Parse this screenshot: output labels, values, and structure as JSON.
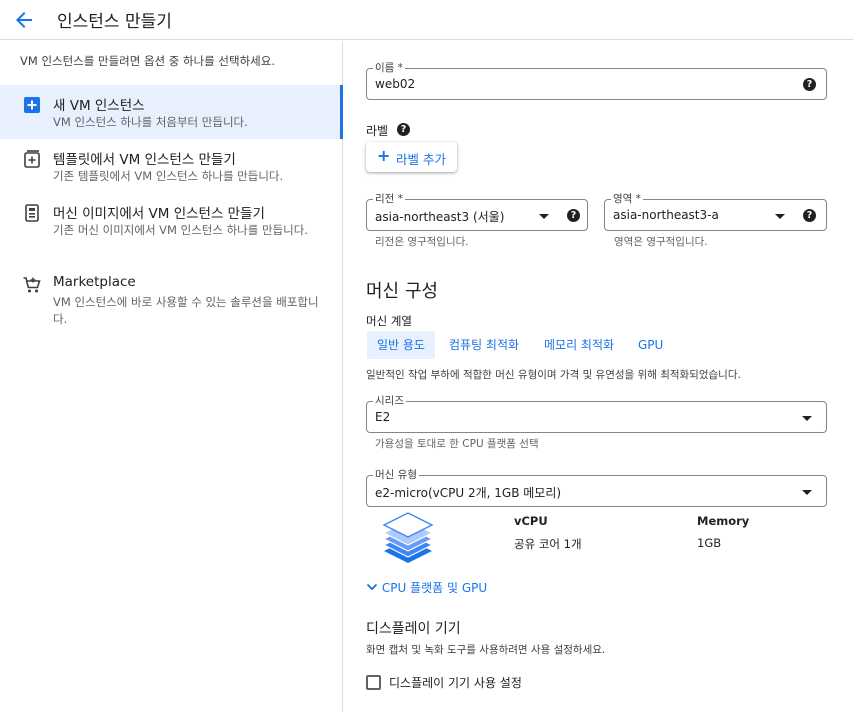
{
  "header": {
    "title": "인스턴스 만들기"
  },
  "sidebar": {
    "description": "VM 인스턴스를 만들려면 옵션 중 하나를 선택하세요.",
    "options": [
      {
        "title": "새 VM 인스턴스",
        "subtitle": "VM 인스턴스 하나를 처음부터 만듭니다."
      },
      {
        "title": "템플릿에서 VM 인스턴스 만들기",
        "subtitle": "기존 템플릿에서 VM 인스턴스 하나를 만듭니다."
      },
      {
        "title": "머신 이미지에서 VM 인스턴스 만들기",
        "subtitle": "기존 머신 이미지에서 VM 인스턴스 하나를 만듭니다."
      },
      {
        "title": "Marketplace",
        "subtitle": "VM 인스턴스에 바로 사용할 수 있는 솔루션을 배포합니다."
      }
    ]
  },
  "form": {
    "name": {
      "label": "이름 *",
      "value": "web02"
    },
    "labels": {
      "title": "라벨",
      "add_button": "라벨 추가"
    },
    "region": {
      "label": "리전 *",
      "value": "asia-northeast3 (서울)",
      "hint": "리전은 영구적입니다."
    },
    "zone": {
      "label": "영역 *",
      "value": "asia-northeast3-a",
      "hint": "영역은 영구적입니다."
    }
  },
  "machine": {
    "heading": "머신 구성",
    "family_label": "머신 계열",
    "tabs": [
      "일반 용도",
      "컴퓨팅 최적화",
      "메모리 최적화",
      "GPU"
    ],
    "family_description": "일반적인 작업 부하에 적합한 머신 유형이며 가격 및 유연성을 위해 최적화되었습니다.",
    "series": {
      "label": "시리즈",
      "value": "E2",
      "hint": "가용성을 토대로 한 CPU 플랫폼 선택"
    },
    "type": {
      "label": "머신 유형",
      "value": "e2-micro(vCPU 2개, 1GB 메모리)"
    },
    "spec": {
      "vcpu_header": "vCPU",
      "vcpu_value": "공유 코어 1개",
      "memory_header": "Memory",
      "memory_value": "1GB"
    },
    "expand_link": "CPU 플랫폼 및 GPU"
  },
  "display": {
    "heading": "디스플레이 기기",
    "description": "화면 캡처 및 녹화 도구를 사용하려면 사용 설정하세요.",
    "checkbox_label": "디스플레이 기기 사용 설정"
  },
  "colors": {
    "accent": "#1a73e8",
    "selected_bg": "#e8f0fe",
    "border": "#dadce0"
  }
}
